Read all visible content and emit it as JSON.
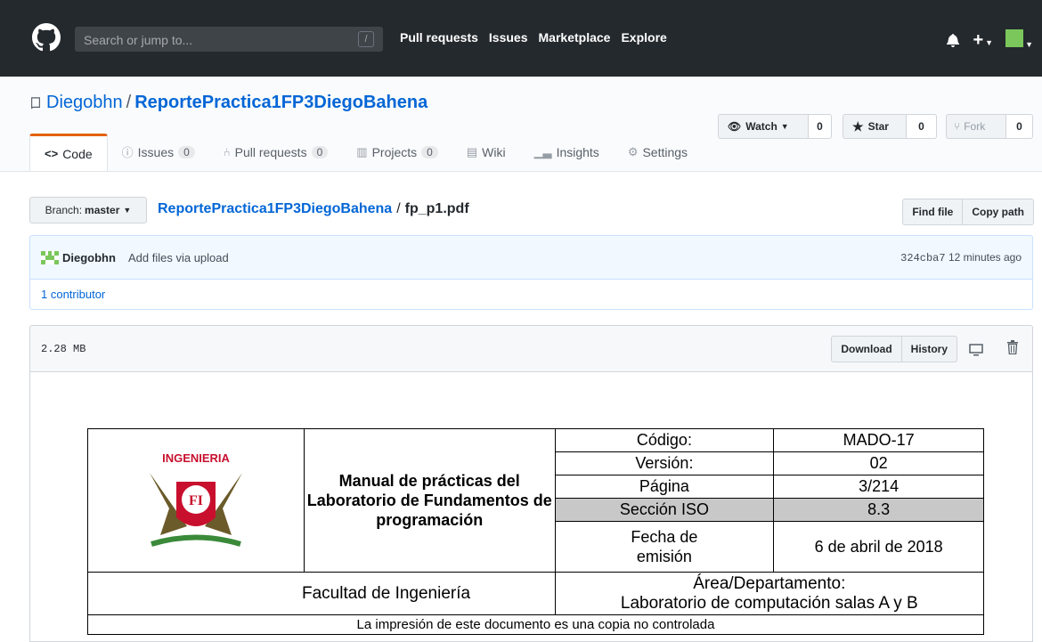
{
  "header": {
    "search_placeholder": "Search or jump to...",
    "slash_key": "/",
    "nav": [
      "Pull requests",
      "Issues",
      "Marketplace",
      "Explore"
    ]
  },
  "repo": {
    "owner": "Diegobhn",
    "separator": "/",
    "name": "ReportePractica1FP3DiegoBahena",
    "watch_label": "Watch",
    "watch_count": "0",
    "star_label": "Star",
    "star_count": "0",
    "fork_label": "Fork",
    "fork_count": "0"
  },
  "tabs": [
    {
      "label": "Code",
      "icon": "code-icon",
      "count": ""
    },
    {
      "label": "Issues",
      "icon": "issue-icon",
      "count": "0"
    },
    {
      "label": "Pull requests",
      "icon": "pull-request-icon",
      "count": "0"
    },
    {
      "label": "Projects",
      "icon": "project-icon",
      "count": "0"
    },
    {
      "label": "Wiki",
      "icon": "book-icon",
      "count": ""
    },
    {
      "label": "Insights",
      "icon": "graph-icon",
      "count": ""
    },
    {
      "label": "Settings",
      "icon": "gear-icon",
      "count": ""
    }
  ],
  "breadcrumb": {
    "branch_prefix": "Branch:",
    "branch": "master",
    "repo": "ReportePractica1FP3DiegoBahena",
    "separator": "/",
    "file": "fp_p1.pdf",
    "find_file": "Find file",
    "copy_path": "Copy path"
  },
  "commit": {
    "author": "Diegobhn",
    "message": "Add files via upload",
    "sha": "324cba7",
    "time": "12 minutes ago",
    "contributors": "1 contributor"
  },
  "file": {
    "size": "2.28 MB",
    "download": "Download",
    "history": "History"
  },
  "pdf": {
    "logo_text": "INGENIERIA",
    "title_line1": "Manual de prácticas del",
    "title_line2": "Laboratorio de Fundamentos de",
    "title_line3": "programación",
    "codigo_label": "Código:",
    "codigo_value": "MADO-17",
    "version_label": "Versión:",
    "version_value": "02",
    "pagina_label": "Página",
    "pagina_value": "3/214",
    "seccion_label": "Sección ISO",
    "seccion_value": "8.3",
    "fecha_label_1": "Fecha de",
    "fecha_label_2": "emisión",
    "fecha_value": "6 de abril de 2018",
    "facultad": "Facultad de Ingeniería",
    "area_label": "Área/Departamento:",
    "area_value": "Laboratorio de computación salas A y B",
    "footer": "La impresión de este documento es una copia no controlada"
  },
  "colors": {
    "header_bg": "#24292e",
    "link": "#0366d6",
    "tab_accent": "#e36209",
    "commit_bg": "#f1f8ff",
    "identicon": "#7bc75b"
  }
}
